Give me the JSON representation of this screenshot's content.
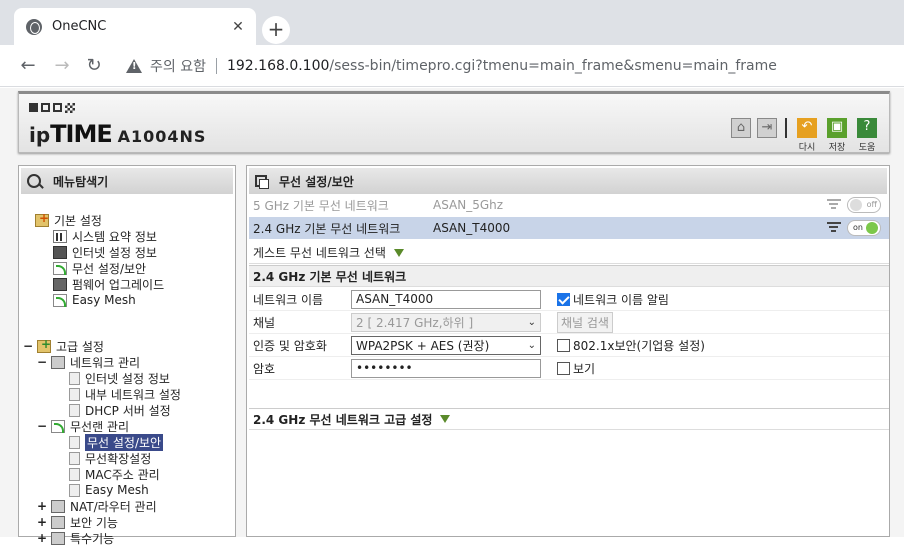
{
  "browser": {
    "tab_title": "OneCNC",
    "security_label": "주의 요함",
    "url_host": "192.168.0.100",
    "url_path": "/sess-bin/timepro.cgi?tmenu=main_frame&smenu=main_frame"
  },
  "header": {
    "brand_ip": "ip",
    "brand_time": "TIME",
    "model": "A1004NS",
    "buttons": [
      {
        "label": "다시",
        "color": "#e6a020"
      },
      {
        "label": "저장",
        "color": "#5aa02c"
      },
      {
        "label": "도움",
        "color": "#3a8a3a"
      }
    ]
  },
  "nav": {
    "title": "메뉴탐색기",
    "basic": {
      "label": "기본 설정",
      "items": [
        "시스템 요약 정보",
        "인터넷 설정 정보",
        "무선 설정/보안",
        "펌웨어 업그레이드",
        "Easy Mesh"
      ]
    },
    "advanced": {
      "label": "고급 설정",
      "network": {
        "label": "네트워크 관리",
        "items": [
          "인터넷 설정 정보",
          "내부 네트워크 설정",
          "DHCP 서버 설정"
        ]
      },
      "wireless": {
        "label": "무선랜 관리",
        "items": [
          "무선 설정/보안",
          "무선확장설정",
          "MAC주소 관리",
          "Easy Mesh"
        ]
      },
      "nat": "NAT/라우터 관리",
      "security": "보안 기능",
      "special": "특수기능"
    }
  },
  "content": {
    "title": "무선 설정/보안",
    "networks": [
      {
        "name": "5 GHz 기본 무선 네트워크",
        "ssid": "ASAN_5Ghz",
        "state": "off"
      },
      {
        "name": "2.4 GHz 기본 무선 네트워크",
        "ssid": "ASAN_T4000",
        "state": "on"
      }
    ],
    "guest_label": "게스트 무선 네트워크 선택",
    "section_title": "2.4 GHz 기본 무선 네트워크",
    "form": {
      "network_name_label": "네트워크 이름",
      "network_name_value": "ASAN_T4000",
      "broadcast_label": "네트워크 이름 알림",
      "channel_label": "채널",
      "channel_value": "2 [ 2.417 GHz,하위 ]",
      "channel_search": "채널 검색",
      "auth_label": "인증 및 암호화",
      "auth_value": "WPA2PSK + AES (권장)",
      "enterprise_label": "802.1x보안(기업용 설정)",
      "password_label": "암호",
      "password_value": "••••••••",
      "show_label": "보기"
    },
    "advanced_title": "2.4 GHz 무선 네트워크 고급 설정"
  }
}
